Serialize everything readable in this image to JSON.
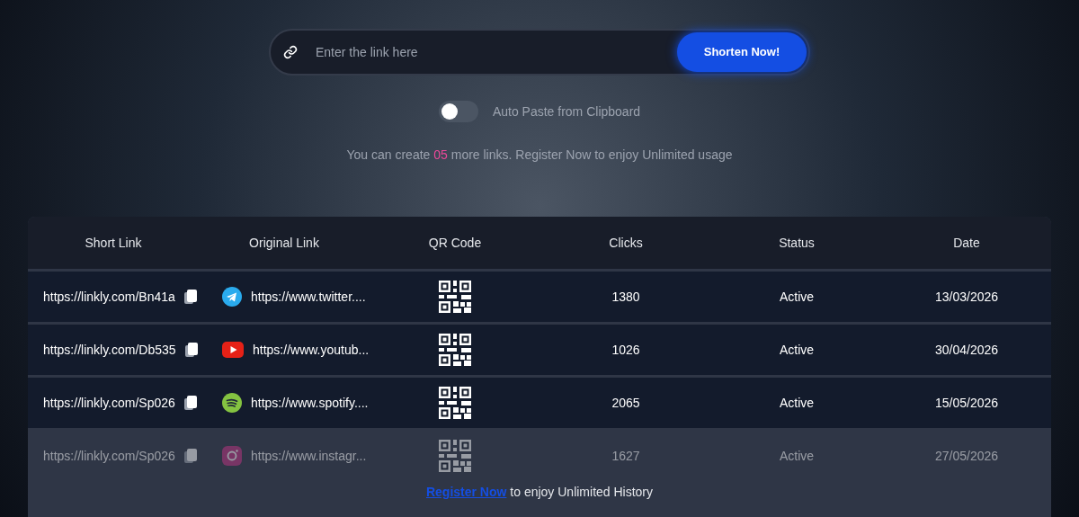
{
  "search": {
    "placeholder": "Enter the link here",
    "button": "Shorten Now!"
  },
  "auto_paste": {
    "label": "Auto Paste from Clipboard",
    "on": false
  },
  "notice": {
    "before": "You can create ",
    "count": "05",
    "after": " more links. Register Now to enjoy Unlimited usage"
  },
  "table": {
    "columns": [
      "Short Link",
      "Original Link",
      "QR Code",
      "Clicks",
      "Status",
      "Date"
    ],
    "rows": [
      {
        "short": "https://linkly.com/Bn41a",
        "kind": "telegram",
        "original": "https://www.twitter....",
        "clicks": "1380",
        "status": "Active",
        "date": "13/03/2026",
        "faded": false
      },
      {
        "short": "https://linkly.com/Db535",
        "kind": "youtube",
        "original": "https://www.youtub...",
        "clicks": "1026",
        "status": "Active",
        "date": "30/04/2026",
        "faded": false
      },
      {
        "short": "https://linkly.com/Sp026",
        "kind": "spotify",
        "original": "https://www.spotify....",
        "clicks": "2065",
        "status": "Active",
        "date": "15/05/2026",
        "faded": false
      },
      {
        "short": "https://linkly.com/Sp026",
        "kind": "instagram",
        "original": "https://www.instagr...",
        "clicks": "1627",
        "status": "Active",
        "date": "27/05/2026",
        "faded": true
      }
    ]
  },
  "history_notice": {
    "link": "Register Now",
    "text": " to enjoy Unlimited History"
  }
}
